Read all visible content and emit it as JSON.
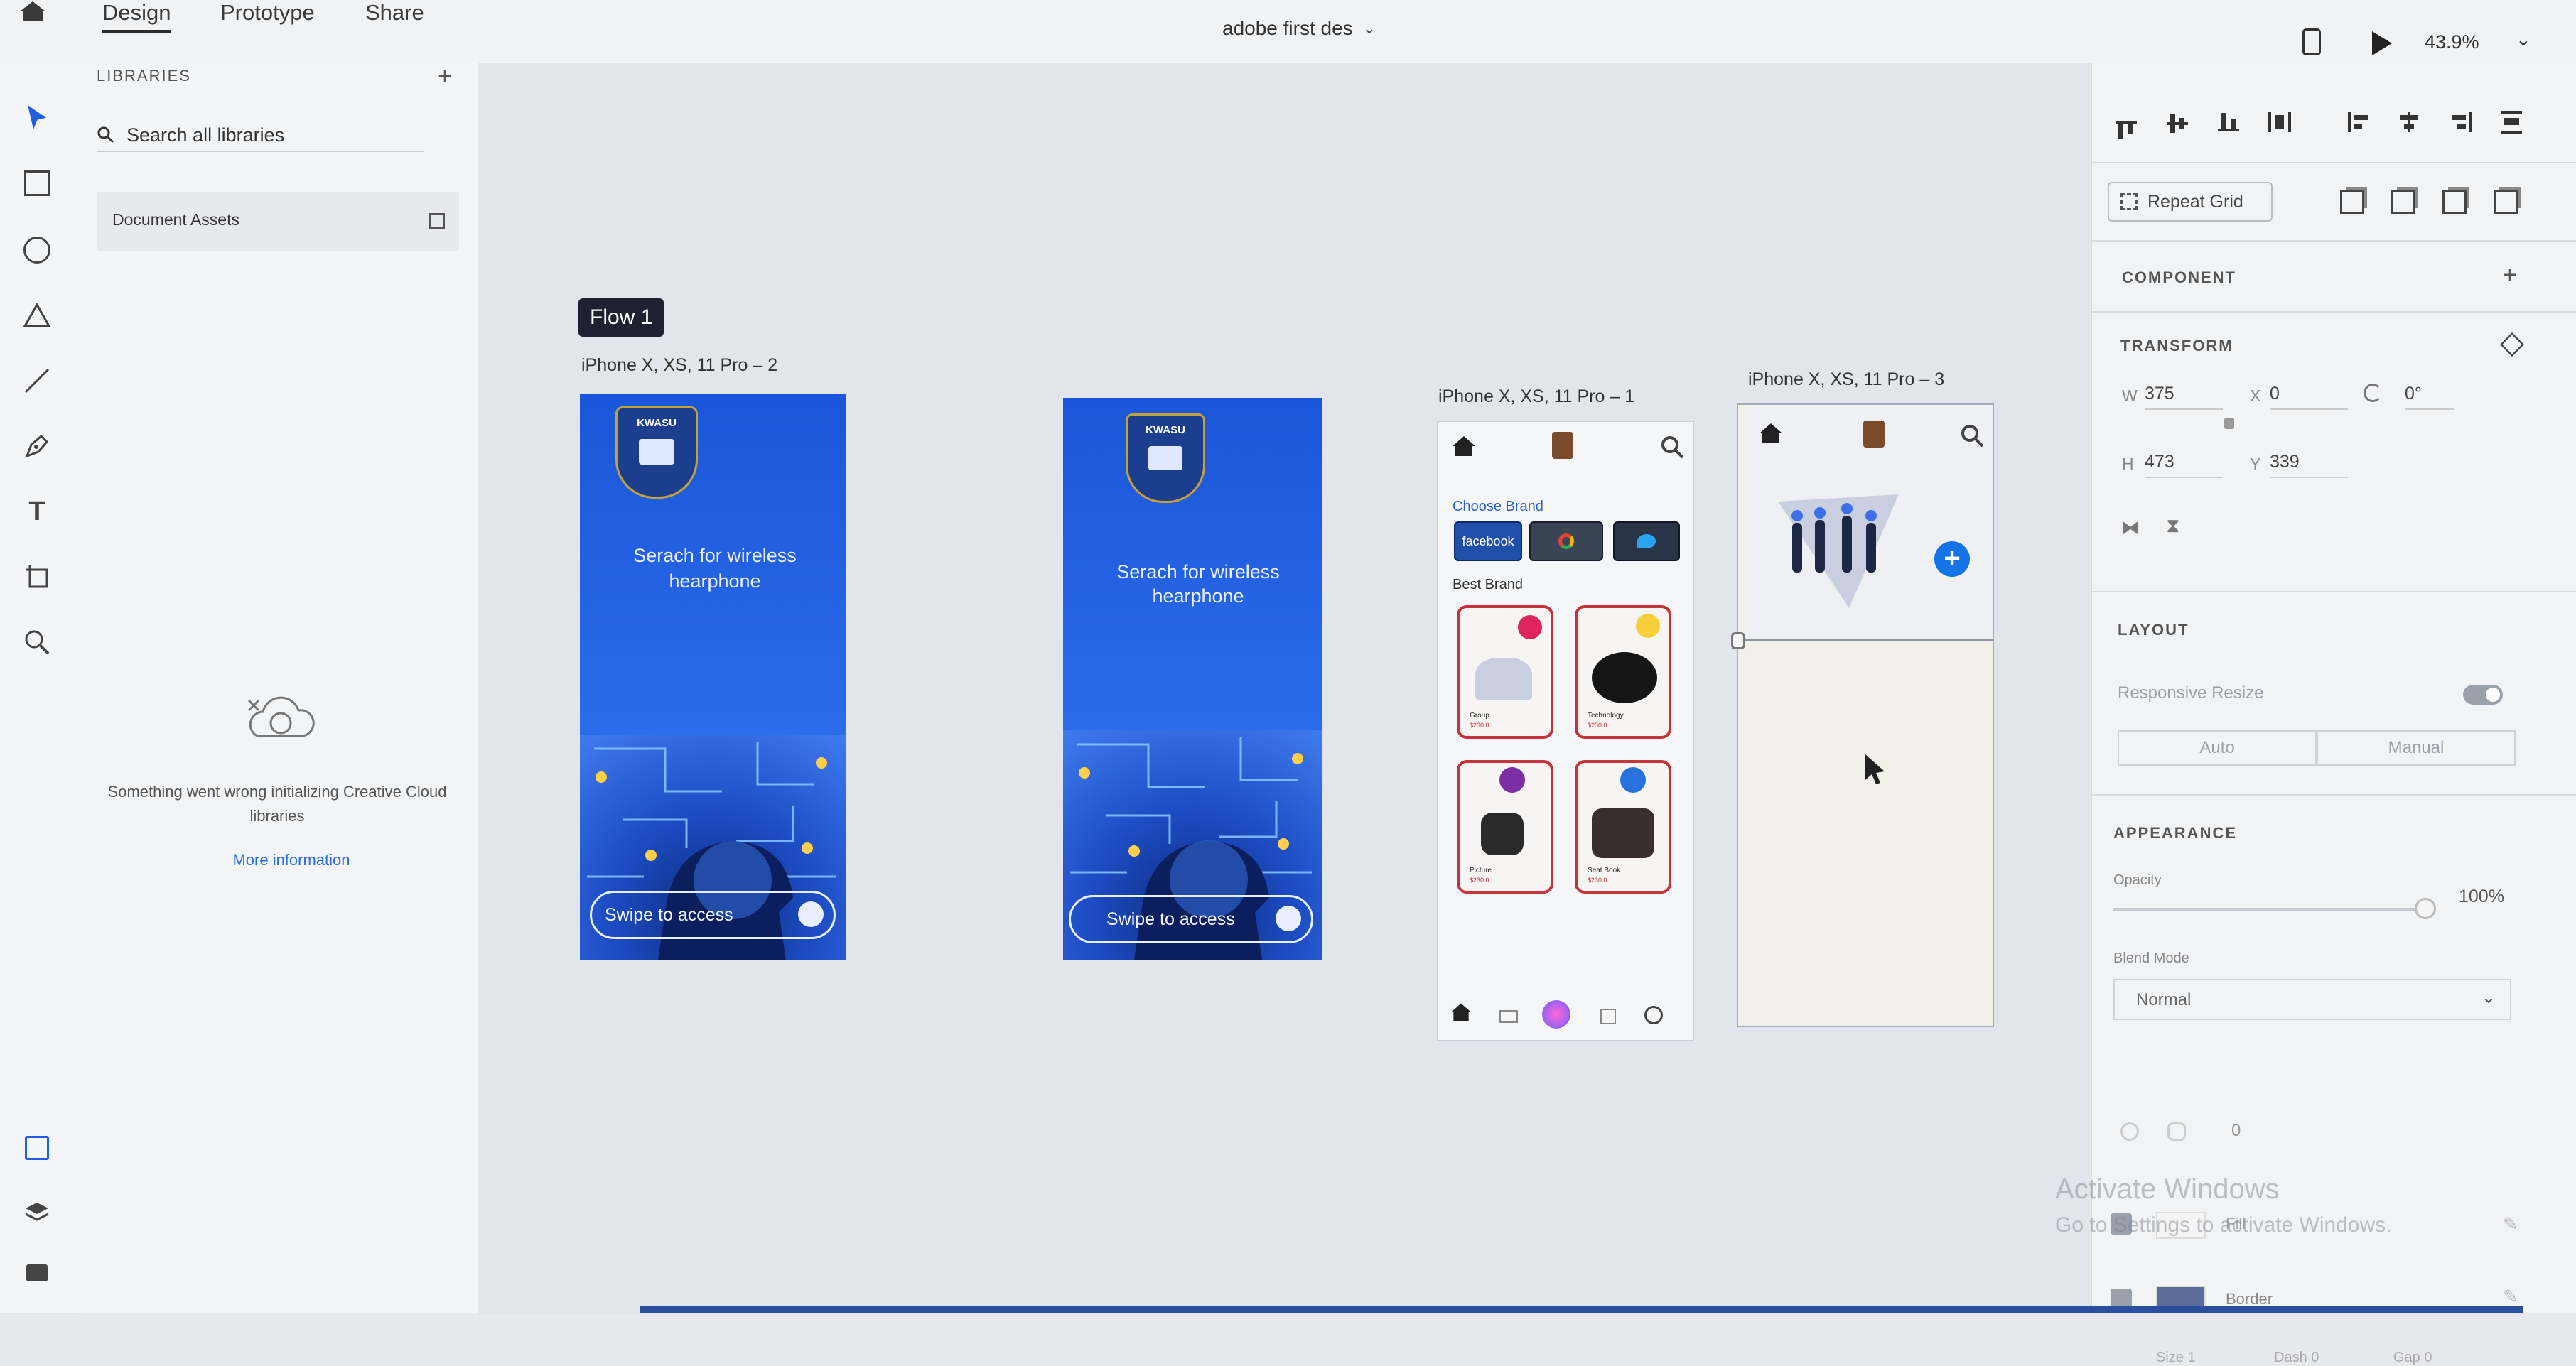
{
  "app": {
    "tabs": [
      "Design",
      "Prototype",
      "Share"
    ],
    "document_title": "adobe first des",
    "zoom": "43.9%"
  },
  "libraries": {
    "title": "LIBRARIES",
    "search_placeholder": "Search all libraries",
    "document_assets": "Document Assets",
    "error_message": "Something went wrong initializing Creative Cloud libraries",
    "more_info": "More information"
  },
  "canvas": {
    "flow_label": "Flow 1",
    "artboards": [
      {
        "label": "iPhone X, XS, 11 Pro – 2",
        "heading": "Serach for wireless hearphone",
        "swipe": "Swipe to access",
        "logo_text": "KWASU"
      },
      {
        "label": "",
        "heading": "Serach for wireless hearphone",
        "swipe": "Swipe to access",
        "logo_text": "KWASU"
      },
      {
        "label": "iPhone X, XS, 11 Pro – 1",
        "choose_brand": "Choose Brand",
        "brands": [
          "facebook",
          "",
          ""
        ],
        "best_brand": "Best Brand",
        "cards": [
          {
            "name": "Group",
            "price": "$230.0"
          },
          {
            "name": "Technology",
            "price": "$230.0"
          },
          {
            "name": "Picture",
            "price": "$230.0"
          },
          {
            "name": "Seat Book",
            "price": "$230.0"
          }
        ]
      },
      {
        "label": "iPhone X, XS, 11 Pro – 3"
      }
    ]
  },
  "properties": {
    "repeat_grid": "Repeat Grid",
    "component": "COMPONENT",
    "transform": "TRANSFORM",
    "w_label": "W",
    "w": "375",
    "x_label": "X",
    "x": "0",
    "rotation": "0°",
    "h_label": "H",
    "h": "473",
    "y_label": "Y",
    "y": "339",
    "layout": "LAYOUT",
    "responsive_resize": "Responsive Resize",
    "auto": "Auto",
    "manual": "Manual",
    "appearance": "APPEARANCE",
    "opacity_label": "Opacity",
    "opacity": "100%",
    "opacity_fraction": 1.0,
    "blend_mode_label": "Blend Mode",
    "blend_mode": "Normal",
    "corner_radius": "0",
    "fill": "Fill",
    "border": "Border",
    "size_label": "Size",
    "size": "1",
    "dash_label": "Dash",
    "dash": "0",
    "gap_label": "Gap",
    "gap": "0"
  },
  "watermark": {
    "line1": "Activate Windows",
    "line2": "Go to Settings to activate Windows."
  },
  "colors": {
    "accent": "#1473e6",
    "artboard_blue": "#2563e3",
    "card_border": "#c8323a"
  }
}
